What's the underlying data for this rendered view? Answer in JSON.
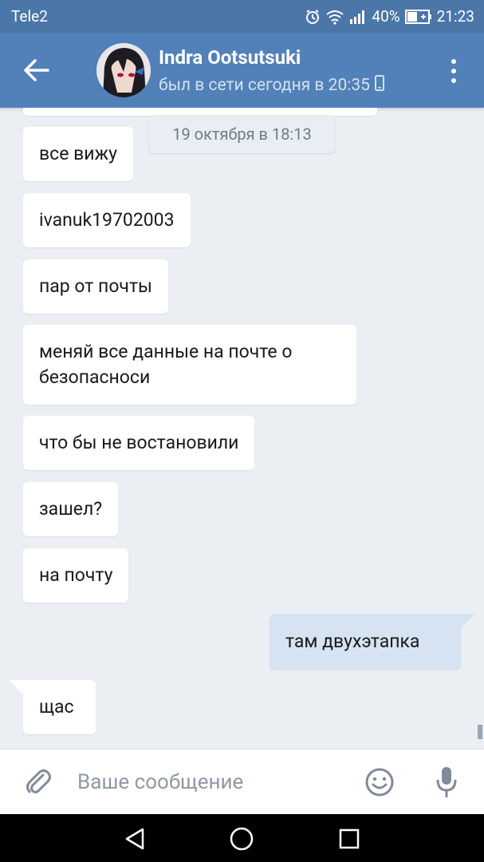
{
  "status_bar": {
    "carrier": "Tele2",
    "battery": "40%",
    "time": "21:23"
  },
  "header": {
    "contact_name": "Indra Ootsutsuki",
    "last_seen": "был в сети сегодня в 20:35"
  },
  "chat": {
    "date_separator": "19 октября в 18:13",
    "messages": [
      {
        "direction": "in",
        "text": "все вижу"
      },
      {
        "direction": "in",
        "text": "ivanuk19702003"
      },
      {
        "direction": "in",
        "text": "пар от почты"
      },
      {
        "direction": "in",
        "text": "меняй все данные на почте о безопасноси"
      },
      {
        "direction": "in",
        "text": "что бы не востановили"
      },
      {
        "direction": "in",
        "text": "зашел?"
      },
      {
        "direction": "in",
        "text": "на почту"
      },
      {
        "direction": "out",
        "text": "там двухэтапка"
      },
      {
        "direction": "in",
        "text": "щас"
      }
    ]
  },
  "composer": {
    "placeholder": "Ваше сообщение"
  },
  "icons": {
    "back": "arrow-left-icon",
    "menu": "more-vertical-icon",
    "attach": "paperclip-icon",
    "emoji": "smile-icon",
    "mic": "microphone-icon",
    "nav_back": "triangle-back-icon",
    "nav_home": "circle-home-icon",
    "nav_recent": "square-recent-icon"
  },
  "colors": {
    "header_bg": "#5181b8",
    "status_bg": "#4a76a8",
    "chat_bg": "#ebeff4",
    "outgoing_bubble": "#d6e3f3",
    "incoming_bubble": "#ffffff"
  }
}
